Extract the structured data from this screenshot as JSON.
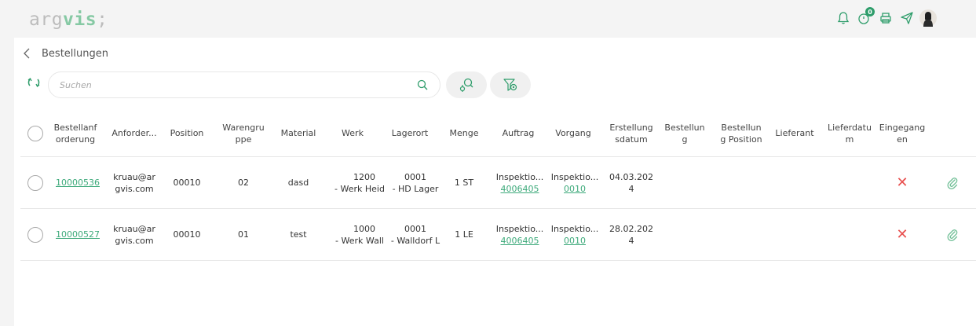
{
  "app": {
    "logo": {
      "part1": "arg",
      "part2": "vis",
      "part3": ";"
    },
    "header_icons": [
      "bell-icon",
      "clock-badge-icon",
      "printer-icon",
      "send-icon",
      "user-avatar"
    ],
    "notification_count": "0",
    "accent_color": "#3eaa7b"
  },
  "breadcrumb": {
    "title": "Bestellungen"
  },
  "search": {
    "placeholder": "Suchen",
    "value": ""
  },
  "table": {
    "columns": [
      "Bestellanf\norderung",
      "Anforder...",
      "Position",
      "Warengru\nppe",
      "Material",
      "Werk",
      "Lagerort",
      "Menge",
      "Auftrag",
      "Vorgang",
      "Erstellung\nsdatum",
      "Bestellun\ng",
      "Bestellun\ng Position",
      "Lieferant",
      "Lieferdatu\nm",
      "Eingegang\nen"
    ],
    "rows": [
      {
        "bestellanforderung": "10000536",
        "anforderer": "kruau@ar\ngvis.com",
        "position": "00010",
        "warengruppe": "02",
        "material": "dasd",
        "werk_code": "1200",
        "werk_name": "- Werk Heid",
        "lagerort_code": "0001",
        "lagerort_name": "- HD Lager",
        "menge": "1 ST",
        "auftrag_text": "Inspektio...",
        "auftrag_link": "4006405",
        "vorgang_text": "Inspektio...",
        "vorgang_link": "0010",
        "erstellungsdatum": "04.03.202\n4",
        "bestellung": "",
        "bestellung_position": "",
        "lieferant": "",
        "lieferdatum": "",
        "eingegangen": "✕"
      },
      {
        "bestellanforderung": "10000527",
        "anforderer": "kruau@ar\ngvis.com",
        "position": "00010",
        "warengruppe": "01",
        "material": "test",
        "werk_code": "1000",
        "werk_name": "- Werk Wall",
        "lagerort_code": "0001",
        "lagerort_name": "- Walldorf L",
        "menge": "1 LE",
        "auftrag_text": "Inspektio...",
        "auftrag_link": "4006405",
        "vorgang_text": "Inspektio...",
        "vorgang_link": "0010",
        "erstellungsdatum": "28.02.202\n4",
        "bestellung": "",
        "bestellung_position": "",
        "lieferant": "",
        "lieferdatum": "",
        "eingegangen": "✕"
      }
    ]
  }
}
